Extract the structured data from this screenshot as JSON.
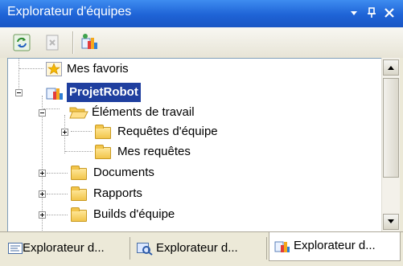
{
  "window": {
    "title": "Explorateur d'équipes",
    "dropdown_glyph": "▾",
    "pin_glyph": "ᵖ",
    "close_glyph": "✕"
  },
  "toolbar": {
    "buttons": [
      {
        "name": "refresh",
        "icon": "refresh-icon"
      },
      {
        "name": "delete",
        "icon": "delete-icon",
        "disabled": true
      },
      {
        "name": "add-project",
        "icon": "add-team-project-icon"
      }
    ]
  },
  "tree": {
    "nodes": [
      {
        "label": "Mes favoris",
        "icon": "favorites-star-icon"
      },
      {
        "label": "ProjetRobot",
        "icon": "team-project-icon",
        "selected": true,
        "expanded": true
      },
      {
        "label": "Éléments de travail",
        "icon": "open-folder-icon",
        "expanded": true
      },
      {
        "label": "Requêtes d'équipe",
        "icon": "folder-icon",
        "expanded": false
      },
      {
        "label": "Mes requêtes",
        "icon": "folder-icon"
      },
      {
        "label": "Documents",
        "icon": "folder-icon",
        "expanded": false
      },
      {
        "label": "Rapports",
        "icon": "folder-icon",
        "expanded": false
      },
      {
        "label": "Builds d'équipe",
        "icon": "folder-icon",
        "expanded": false
      }
    ]
  },
  "tabs": [
    {
      "label": "Explorateur d...",
      "icon": "document-outline-icon",
      "active": false
    },
    {
      "label": "Explorateur d...",
      "icon": "server-explorer-icon",
      "active": false
    },
    {
      "label": "Explorateur d...",
      "icon": "team-explorer-icon",
      "active": true
    }
  ],
  "colors": {
    "titlebar": "#1E63D6",
    "selection": "#1F3F9F",
    "chrome": "#ECE9D8"
  }
}
